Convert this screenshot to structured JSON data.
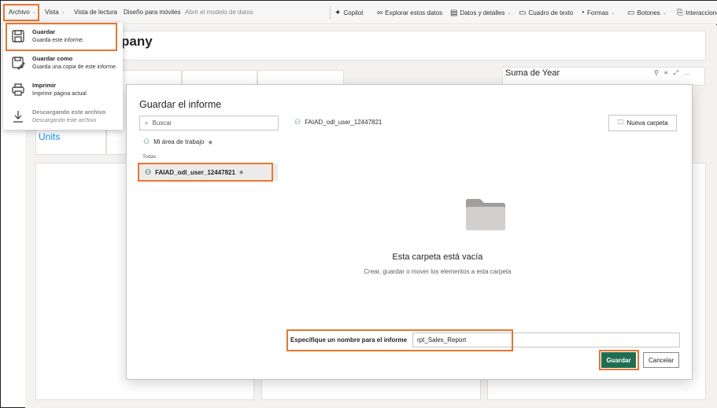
{
  "ribbon": {
    "archivo": "Archivo",
    "vista": "Vista",
    "vista_lectura": "Vista de lectura",
    "diseno_moviles": "Diseño para móviles",
    "abrir_modelo": "Abrir el modelo de datos",
    "copilot": "Copilot",
    "explorar": "Explorar estos datos",
    "datos_detalles": "Datos y detalles",
    "cuadro_texto": "Cuadro de texto",
    "formas": "Formas",
    "botones": "Botones",
    "interacciones": "Interacciones"
  },
  "file_menu": [
    {
      "title": "Guardar",
      "subtitle": "Guarda este informe.",
      "icon": "save-icon"
    },
    {
      "title": "Guardar como",
      "subtitle": "Guarda una copia de este informe.",
      "icon": "save-as-icon"
    },
    {
      "title": "Imprimir",
      "subtitle": "Imprimir página actual",
      "icon": "print-icon"
    },
    {
      "title": "Descargando este archivo",
      "subtitle": "Descargando este archivo",
      "icon": "download-icon"
    }
  ],
  "canvas": {
    "title_fragment": "pany",
    "units_label": "Units",
    "suma_label": "Suma de Year"
  },
  "dialog": {
    "title": "Guardar el informe",
    "search_placeholder": "Buscar",
    "my_workspace": "Mi área de trabajo",
    "all_label": "Todas",
    "selected_workspace": "FAIAD_odl_user_12447821",
    "breadcrumb": "FAIAD_odl_user_12447821",
    "new_folder": "Nueva carpeta",
    "empty_title": "Esta carpeta está vacía",
    "empty_subtitle": "Crear, guardar o mover los elementos a esta carpeta",
    "name_label": "Especifique un nombre para el informe",
    "name_value": "rpt_Sales_Report",
    "save_button": "Guardar",
    "cancel_button": "Cancelar"
  },
  "colors": {
    "highlight": "#e8762d",
    "primary_button": "#1f6e53",
    "workspace_icon": "#3a8a68",
    "accent_text": "#118dff"
  }
}
